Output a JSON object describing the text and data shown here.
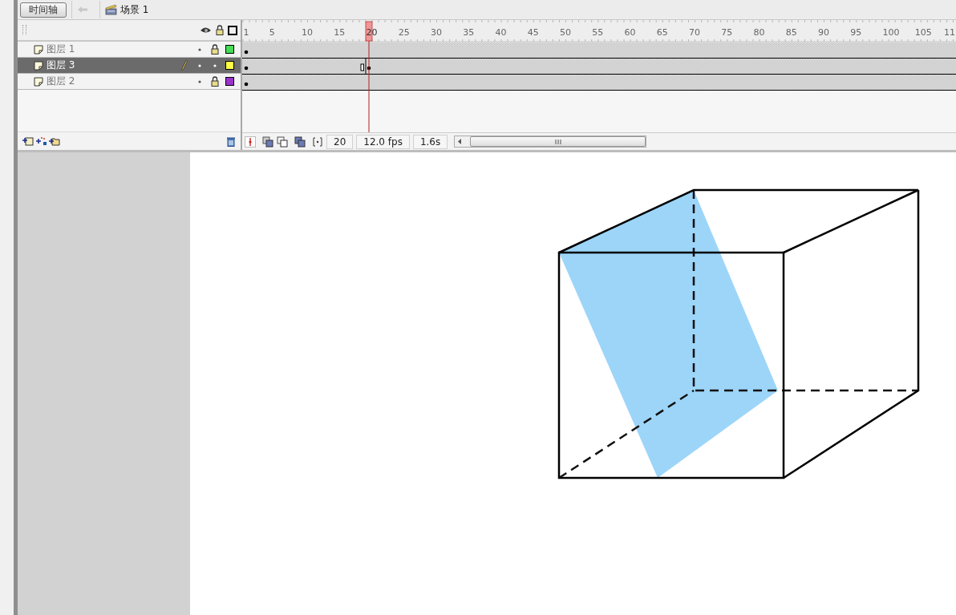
{
  "timeline_button": "时间轴",
  "scene": "场景 1",
  "layers": [
    {
      "name": "图层 1",
      "selected": false,
      "locked": true,
      "color": "#44dd55",
      "keyframe_at_playhead": false
    },
    {
      "name": "图层 3",
      "selected": true,
      "locked": false,
      "color": "#ffff44",
      "keyframe_at_playhead": true
    },
    {
      "name": "图层 2",
      "selected": false,
      "locked": true,
      "color": "#9933cc",
      "keyframe_at_playhead": false
    }
  ],
  "ruler": [
    {
      "label": "1",
      "selected": false
    },
    {
      "label": "5",
      "selected": false
    },
    {
      "label": "10",
      "selected": false
    },
    {
      "label": "15",
      "selected": false
    },
    {
      "label": "20",
      "selected": true
    },
    {
      "label": "25",
      "selected": false
    },
    {
      "label": "30",
      "selected": false
    },
    {
      "label": "35",
      "selected": false
    },
    {
      "label": "40",
      "selected": false
    },
    {
      "label": "45",
      "selected": false
    },
    {
      "label": "50",
      "selected": false
    },
    {
      "label": "55",
      "selected": false
    },
    {
      "label": "60",
      "selected": false
    },
    {
      "label": "65",
      "selected": false
    },
    {
      "label": "70",
      "selected": false
    },
    {
      "label": "75",
      "selected": false
    },
    {
      "label": "80",
      "selected": false
    },
    {
      "label": "85",
      "selected": false
    },
    {
      "label": "90",
      "selected": false
    },
    {
      "label": "95",
      "selected": false
    },
    {
      "label": "100",
      "selected": false
    },
    {
      "label": "105",
      "selected": false
    },
    {
      "label": "11",
      "selected": false
    }
  ],
  "current_frame": "20",
  "frame_rate": "12.0 fps",
  "elapsed_time": "1.6s"
}
